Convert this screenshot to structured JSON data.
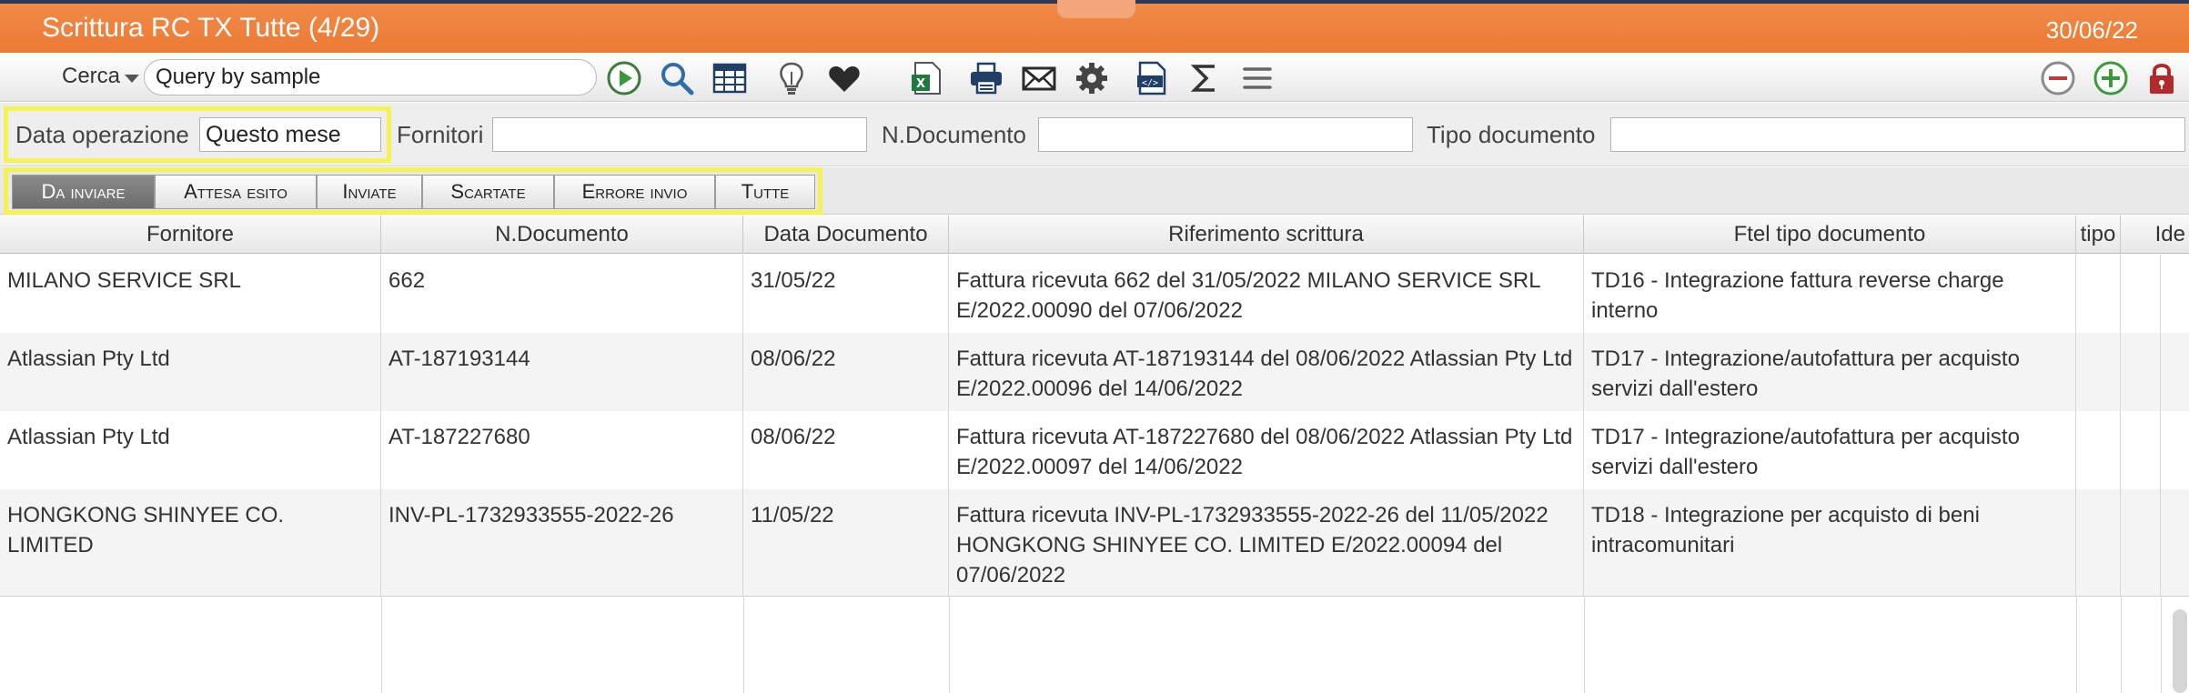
{
  "window": {
    "title": "Scrittura RC TX Tutte (4/29)",
    "date": "30/06/22"
  },
  "toolbar": {
    "search_label": "Cerca",
    "query_value": "Query by sample",
    "icons": [
      "play-icon",
      "search-icon",
      "grid-icon",
      "lightbulb-icon",
      "heart-icon",
      "excel-icon",
      "print-icon",
      "mail-icon",
      "gear-icon",
      "xml-icon",
      "sigma-icon",
      "menu-icon",
      "remove-icon",
      "add-icon",
      "lock-icon"
    ]
  },
  "filters": {
    "data_operazione_label": "Data operazione",
    "data_operazione_value": "Questo mese",
    "fornitori_label": "Fornitori",
    "fornitori_value": "",
    "ndocumento_label": "N.Documento",
    "ndocumento_value": "",
    "tipo_documento_label": "Tipo documento",
    "tipo_documento_value": ""
  },
  "tabs": [
    {
      "label": "Da inviare",
      "active": true
    },
    {
      "label": "Attesa esito",
      "active": false
    },
    {
      "label": "Inviate",
      "active": false
    },
    {
      "label": "Scartate",
      "active": false
    },
    {
      "label": "Errore invio",
      "active": false
    },
    {
      "label": "Tutte",
      "active": false
    }
  ],
  "table": {
    "columns": [
      "Fornitore",
      "N.Documento",
      "Data Documento",
      "Riferimento scrittura",
      "Ftel tipo documento",
      "tipo",
      "Ide"
    ],
    "rows": [
      {
        "fornitore": "MILANO SERVICE SRL",
        "ndocumento": "662",
        "data": "31/05/22",
        "riferimento": "Fattura ricevuta 662 del 31/05/2022 MILANO SERVICE SRL E/2022.00090 del 07/06/2022",
        "ftel": "TD16 - Integrazione fattura reverse charge interno"
      },
      {
        "fornitore": "Atlassian Pty Ltd",
        "ndocumento": "AT-187193144",
        "data": "08/06/22",
        "riferimento": "Fattura ricevuta AT-187193144 del 08/06/2022 Atlassian Pty Ltd E/2022.00096 del 14/06/2022",
        "ftel": "TD17 - Integrazione/autofattura per acquisto servizi dall'estero"
      },
      {
        "fornitore": "Atlassian Pty Ltd",
        "ndocumento": "AT-187227680",
        "data": "08/06/22",
        "riferimento": "Fattura ricevuta AT-187227680 del 08/06/2022 Atlassian Pty Ltd E/2022.00097 del 14/06/2022",
        "ftel": "TD17 - Integrazione/autofattura per acquisto servizi dall'estero"
      },
      {
        "fornitore": "HONGKONG SHINYEE CO. LIMITED",
        "ndocumento": "INV-PL-1732933555-2022-26",
        "data": "11/05/22",
        "riferimento": "Fattura ricevuta INV-PL-1732933555-2022-26 del 11/05/2022 HONGKONG SHINYEE CO. LIMITED E/2022.00094 del 07/06/2022",
        "ftel": "TD18 - Integrazione per acquisto di beni intracomunitari"
      }
    ]
  }
}
